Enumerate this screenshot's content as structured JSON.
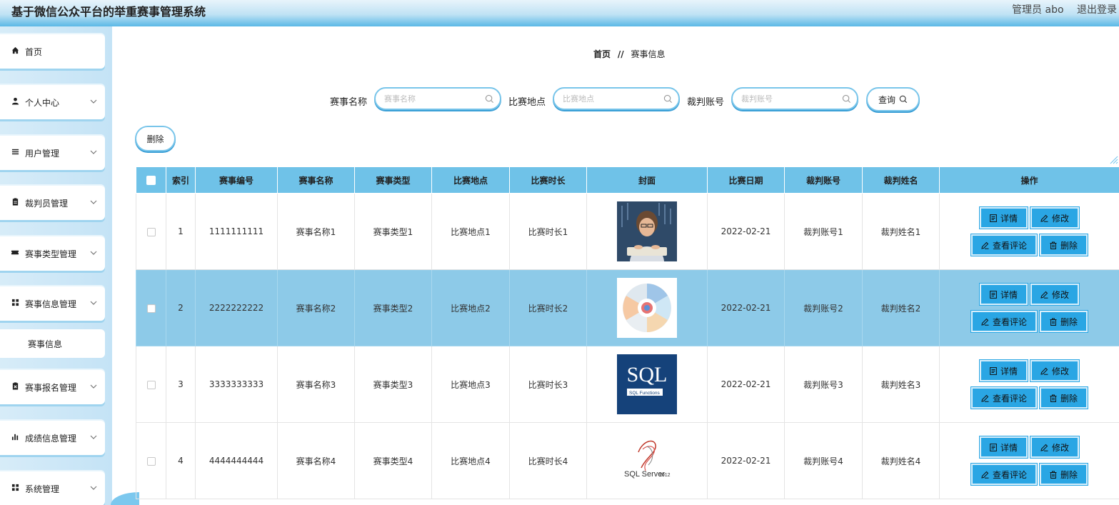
{
  "header": {
    "title": "基于微信公众平台的举重赛事管理系统",
    "admin": "管理员 abo",
    "logout": "退出登录"
  },
  "sidebar": {
    "items": [
      {
        "label": "首页",
        "icon": "home-icon"
      },
      {
        "label": "个人中心",
        "icon": "user-icon"
      },
      {
        "label": "用户管理",
        "icon": "list-icon"
      },
      {
        "label": "裁判员管理",
        "icon": "clipboard-icon"
      },
      {
        "label": "赛事类型管理",
        "icon": "ticket-icon"
      },
      {
        "label": "赛事信息管理",
        "icon": "grid-icon"
      },
      {
        "label": "赛事报名管理",
        "icon": "clipboard-x-icon"
      },
      {
        "label": "成绩信息管理",
        "icon": "bar-chart-icon"
      },
      {
        "label": "系统管理",
        "icon": "grid-icon"
      }
    ],
    "sub_item": "赛事信息"
  },
  "breadcrumb": {
    "home": "首页",
    "sep": "//",
    "current": "赛事信息"
  },
  "search": {
    "name_label": "赛事名称",
    "name_placeholder": "赛事名称",
    "place_label": "比赛地点",
    "place_placeholder": "比赛地点",
    "judge_label": "裁判账号",
    "judge_placeholder": "裁判账号",
    "query_label": "查询"
  },
  "toolbar": {
    "delete_label": "删除"
  },
  "table": {
    "headers": [
      "",
      "索引",
      "赛事编号",
      "赛事名称",
      "赛事类型",
      "比赛地点",
      "比赛时长",
      "封面",
      "比赛日期",
      "裁判账号",
      "裁判姓名",
      "操作"
    ],
    "rows": [
      {
        "index": "1",
        "code": "1111111111",
        "name": "赛事名称1",
        "type": "赛事类型1",
        "place": "比赛地点1",
        "duration": "比赛时长1",
        "date": "2022-02-21",
        "judge_account": "裁判账号1",
        "judge_name": "裁判姓名1"
      },
      {
        "index": "2",
        "code": "2222222222",
        "name": "赛事名称2",
        "type": "赛事类型2",
        "place": "比赛地点2",
        "duration": "比赛时长2",
        "date": "2022-02-21",
        "judge_account": "裁判账号2",
        "judge_name": "裁判姓名2"
      },
      {
        "index": "3",
        "code": "3333333333",
        "name": "赛事名称3",
        "type": "赛事类型3",
        "place": "比赛地点3",
        "duration": "比赛时长3",
        "date": "2022-02-21",
        "judge_account": "裁判账号3",
        "judge_name": "裁判姓名3"
      },
      {
        "index": "4",
        "code": "4444444444",
        "name": "赛事名称4",
        "type": "赛事类型4",
        "place": "比赛地点4",
        "duration": "比赛时长4",
        "date": "2022-02-21",
        "judge_account": "裁判账号4",
        "judge_name": "裁判姓名4"
      }
    ],
    "ops": {
      "detail": "详情",
      "edit": "修改",
      "comments": "查看评论",
      "delete": "删除"
    }
  },
  "covers": {
    "sql_text": "SQL",
    "sql_sub": "SQL Functions",
    "sqlserver_text": "SQL Server",
    "sqlserver_year": "2012"
  },
  "colors": {
    "accent": "#2aa6e4",
    "header_blue": "#5bb8e6",
    "row_highlight": "#8dcae8"
  }
}
